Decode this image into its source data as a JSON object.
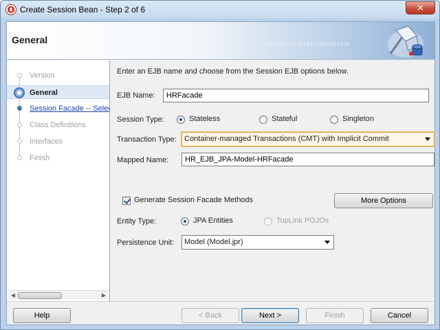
{
  "window": {
    "title": "Create Session Bean - Step 2 of 6",
    "close_glyph": "✕"
  },
  "header": {
    "title": "General",
    "binary_text": "0101010101010101010101010"
  },
  "steps": [
    {
      "label": "Version",
      "state": "done"
    },
    {
      "label": "General",
      "state": "current"
    },
    {
      "label": "Session Facade -- Select",
      "state": "link"
    },
    {
      "label": "Class Definitions",
      "state": "pending"
    },
    {
      "label": "Interfaces",
      "state": "pending"
    },
    {
      "label": "Finish",
      "state": "pending"
    }
  ],
  "form": {
    "intro": "Enter an EJB name and choose from the Session EJB options below.",
    "ejb_name_label": "EJB Name:",
    "ejb_name_value": "HRFacade",
    "session_type_label": "Session Type:",
    "session_types": [
      {
        "label": "Stateless",
        "selected": true
      },
      {
        "label": "Stateful",
        "selected": false
      },
      {
        "label": "Singleton",
        "selected": false
      }
    ],
    "transaction_type_label": "Transaction Type:",
    "transaction_type_value": "Container-managed Transactions (CMT) with Implicit Commit",
    "mapped_name_label": "Mapped Name:",
    "mapped_name_value": "HR_EJB_JPA-Model-HRFacade",
    "generate_facade_label": "Generate Session Facade Methods",
    "generate_facade_checked": true,
    "more_options_label": "More Options",
    "entity_type_label": "Entity Type:",
    "entity_types": [
      {
        "label": "JPA Entities",
        "selected": true,
        "enabled": true
      },
      {
        "label": "TopLink POJOs",
        "selected": false,
        "enabled": false
      }
    ],
    "persistence_unit_label": "Persistence Unit:",
    "persistence_unit_value": "Model (Model.jpr)"
  },
  "buttons": {
    "help": "Help",
    "back": "< Back",
    "next": "Next >",
    "finish": "Finish",
    "cancel": "Cancel"
  },
  "scroll": {
    "left_glyph": "◀",
    "right_glyph": "▶"
  },
  "colors": {
    "title_gradient_top": "#dbe8f6",
    "selected_step_bg": "#dfe8f5",
    "link_color": "#1a3fa8",
    "close_button": "#c7503c",
    "focus_border": "#d6a148"
  }
}
